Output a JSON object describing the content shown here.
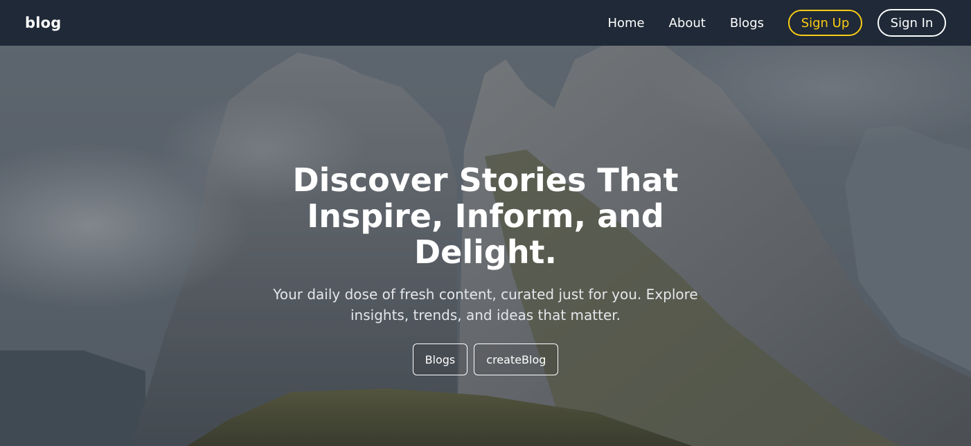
{
  "navbar": {
    "brand": "blog",
    "links": [
      "Home",
      "About",
      "Blogs"
    ],
    "signup_label": "Sign Up",
    "signin_label": "Sign In",
    "colors": {
      "background": "#1f2937",
      "accent": "#facc15"
    }
  },
  "hero": {
    "title": "Discover Stories That Inspire, Inform, and Delight.",
    "subtitle": "Your daily dose of fresh content, curated just for you. Explore insights, trends, and ideas that matter.",
    "buttons": [
      "Blogs",
      "createBlog"
    ],
    "background": "mountain-landscape-photo"
  }
}
